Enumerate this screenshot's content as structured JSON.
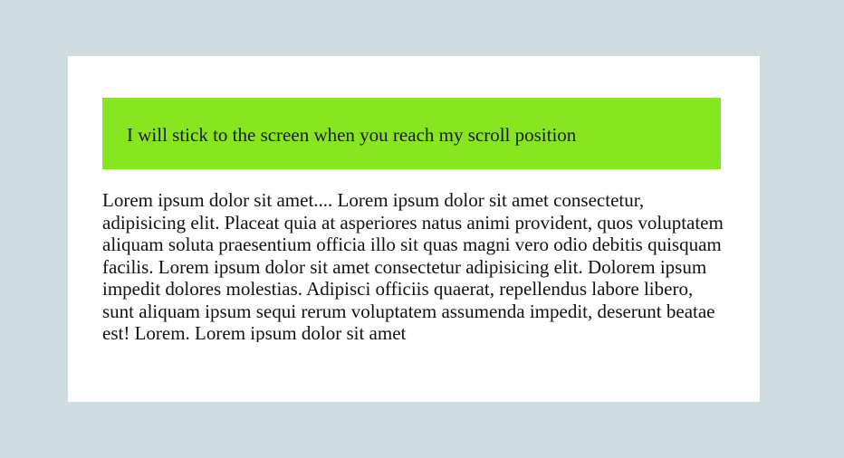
{
  "sticky": {
    "text": "I will stick to the screen when you reach my scroll position",
    "background": "#87e61f"
  },
  "content": {
    "text": "Lorem ipsum dolor sit amet.... Lorem ipsum dolor sit amet consectetur, adipisicing elit. Placeat quia at asperiores natus animi provident, quos voluptatem aliquam soluta praesentium officia illo sit quas magni vero odio debitis quisquam facilis. Lorem ipsum dolor sit amet consectetur adipisicing elit. Dolorem ipsum impedit dolores molestias. Adipisci officiis quaerat, repellendus labore libero, sunt aliquam ipsum sequi rerum voluptatem assumenda impedit, deserunt beatae est! Lorem. Lorem ipsum dolor sit amet"
  },
  "colors": {
    "page_background": "#d0dde0",
    "card_background": "#ffffff"
  }
}
